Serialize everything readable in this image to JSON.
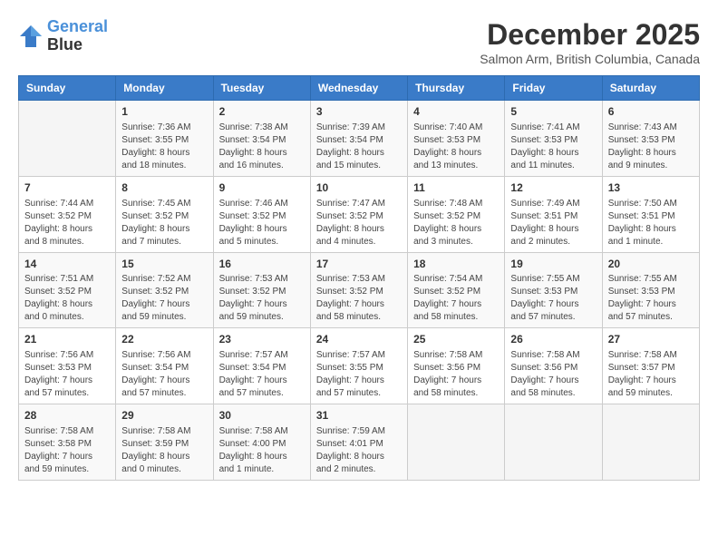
{
  "header": {
    "logo_line1": "General",
    "logo_line2": "Blue",
    "month_title": "December 2025",
    "location": "Salmon Arm, British Columbia, Canada"
  },
  "weekdays": [
    "Sunday",
    "Monday",
    "Tuesday",
    "Wednesday",
    "Thursday",
    "Friday",
    "Saturday"
  ],
  "weeks": [
    [
      {
        "day": "",
        "info": ""
      },
      {
        "day": "1",
        "info": "Sunrise: 7:36 AM\nSunset: 3:55 PM\nDaylight: 8 hours\nand 18 minutes."
      },
      {
        "day": "2",
        "info": "Sunrise: 7:38 AM\nSunset: 3:54 PM\nDaylight: 8 hours\nand 16 minutes."
      },
      {
        "day": "3",
        "info": "Sunrise: 7:39 AM\nSunset: 3:54 PM\nDaylight: 8 hours\nand 15 minutes."
      },
      {
        "day": "4",
        "info": "Sunrise: 7:40 AM\nSunset: 3:53 PM\nDaylight: 8 hours\nand 13 minutes."
      },
      {
        "day": "5",
        "info": "Sunrise: 7:41 AM\nSunset: 3:53 PM\nDaylight: 8 hours\nand 11 minutes."
      },
      {
        "day": "6",
        "info": "Sunrise: 7:43 AM\nSunset: 3:53 PM\nDaylight: 8 hours\nand 9 minutes."
      }
    ],
    [
      {
        "day": "7",
        "info": "Sunrise: 7:44 AM\nSunset: 3:52 PM\nDaylight: 8 hours\nand 8 minutes."
      },
      {
        "day": "8",
        "info": "Sunrise: 7:45 AM\nSunset: 3:52 PM\nDaylight: 8 hours\nand 7 minutes."
      },
      {
        "day": "9",
        "info": "Sunrise: 7:46 AM\nSunset: 3:52 PM\nDaylight: 8 hours\nand 5 minutes."
      },
      {
        "day": "10",
        "info": "Sunrise: 7:47 AM\nSunset: 3:52 PM\nDaylight: 8 hours\nand 4 minutes."
      },
      {
        "day": "11",
        "info": "Sunrise: 7:48 AM\nSunset: 3:52 PM\nDaylight: 8 hours\nand 3 minutes."
      },
      {
        "day": "12",
        "info": "Sunrise: 7:49 AM\nSunset: 3:51 PM\nDaylight: 8 hours\nand 2 minutes."
      },
      {
        "day": "13",
        "info": "Sunrise: 7:50 AM\nSunset: 3:51 PM\nDaylight: 8 hours\nand 1 minute."
      }
    ],
    [
      {
        "day": "14",
        "info": "Sunrise: 7:51 AM\nSunset: 3:52 PM\nDaylight: 8 hours\nand 0 minutes."
      },
      {
        "day": "15",
        "info": "Sunrise: 7:52 AM\nSunset: 3:52 PM\nDaylight: 7 hours\nand 59 minutes."
      },
      {
        "day": "16",
        "info": "Sunrise: 7:53 AM\nSunset: 3:52 PM\nDaylight: 7 hours\nand 59 minutes."
      },
      {
        "day": "17",
        "info": "Sunrise: 7:53 AM\nSunset: 3:52 PM\nDaylight: 7 hours\nand 58 minutes."
      },
      {
        "day": "18",
        "info": "Sunrise: 7:54 AM\nSunset: 3:52 PM\nDaylight: 7 hours\nand 58 minutes."
      },
      {
        "day": "19",
        "info": "Sunrise: 7:55 AM\nSunset: 3:53 PM\nDaylight: 7 hours\nand 57 minutes."
      },
      {
        "day": "20",
        "info": "Sunrise: 7:55 AM\nSunset: 3:53 PM\nDaylight: 7 hours\nand 57 minutes."
      }
    ],
    [
      {
        "day": "21",
        "info": "Sunrise: 7:56 AM\nSunset: 3:53 PM\nDaylight: 7 hours\nand 57 minutes."
      },
      {
        "day": "22",
        "info": "Sunrise: 7:56 AM\nSunset: 3:54 PM\nDaylight: 7 hours\nand 57 minutes."
      },
      {
        "day": "23",
        "info": "Sunrise: 7:57 AM\nSunset: 3:54 PM\nDaylight: 7 hours\nand 57 minutes."
      },
      {
        "day": "24",
        "info": "Sunrise: 7:57 AM\nSunset: 3:55 PM\nDaylight: 7 hours\nand 57 minutes."
      },
      {
        "day": "25",
        "info": "Sunrise: 7:58 AM\nSunset: 3:56 PM\nDaylight: 7 hours\nand 58 minutes."
      },
      {
        "day": "26",
        "info": "Sunrise: 7:58 AM\nSunset: 3:56 PM\nDaylight: 7 hours\nand 58 minutes."
      },
      {
        "day": "27",
        "info": "Sunrise: 7:58 AM\nSunset: 3:57 PM\nDaylight: 7 hours\nand 59 minutes."
      }
    ],
    [
      {
        "day": "28",
        "info": "Sunrise: 7:58 AM\nSunset: 3:58 PM\nDaylight: 7 hours\nand 59 minutes."
      },
      {
        "day": "29",
        "info": "Sunrise: 7:58 AM\nSunset: 3:59 PM\nDaylight: 8 hours\nand 0 minutes."
      },
      {
        "day": "30",
        "info": "Sunrise: 7:58 AM\nSunset: 4:00 PM\nDaylight: 8 hours\nand 1 minute."
      },
      {
        "day": "31",
        "info": "Sunrise: 7:59 AM\nSunset: 4:01 PM\nDaylight: 8 hours\nand 2 minutes."
      },
      {
        "day": "",
        "info": ""
      },
      {
        "day": "",
        "info": ""
      },
      {
        "day": "",
        "info": ""
      }
    ]
  ]
}
